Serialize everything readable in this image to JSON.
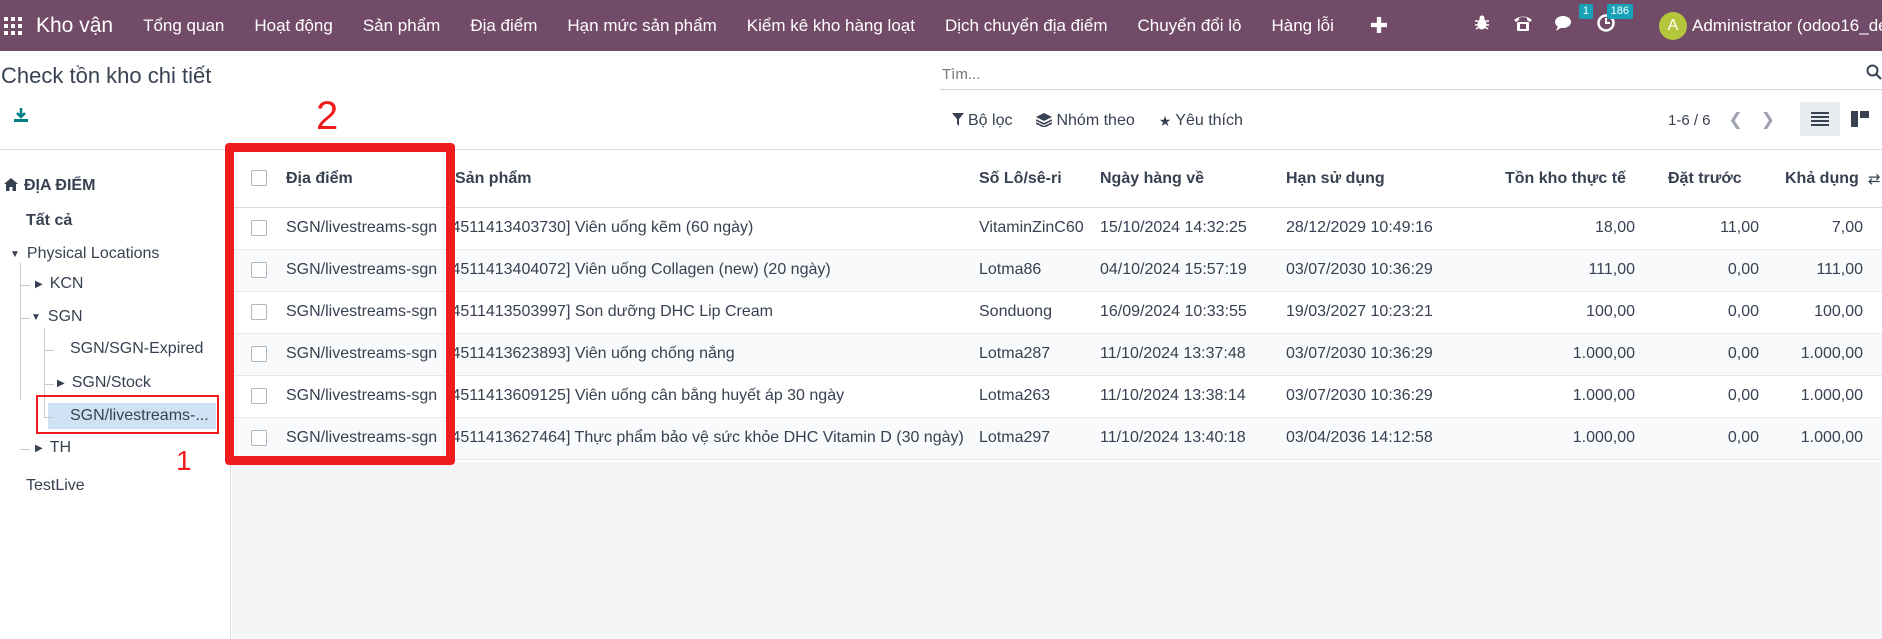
{
  "navbar": {
    "brand": "Kho vận",
    "menu": [
      "Tổng quan",
      "Hoạt động",
      "Sản phẩm",
      "Địa điểm",
      "Hạn mức sản phẩm",
      "Kiểm kê kho hàng loạt",
      "Dịch chuyển địa điểm",
      "Chuyển đổi lô",
      "Hàng lỗi"
    ],
    "chat_badge": "1",
    "activity_badge": "186",
    "avatar_letter": "A",
    "username": "Administrator (odoo16_dev"
  },
  "page": {
    "title": "Check tồn kho chi tiết",
    "search_placeholder": "Tìm...",
    "filter_label": "Bộ lọc",
    "group_label": "Nhóm theo",
    "favorite_label": "Yêu thích",
    "pager": "1-6 / 6"
  },
  "sidebar": {
    "header": "ĐỊA ĐIỂM",
    "all": "Tất cả",
    "physical": "Physical Locations",
    "kcn": "KCN",
    "sgn": "SGN",
    "sgn_expired": "SGN/SGN-Expired",
    "sgn_stock": "SGN/Stock",
    "sgn_live": "SGN/livestreams-...",
    "th": "TH",
    "testlive": "TestLive"
  },
  "annotations": {
    "label_1": "1",
    "label_2": "2"
  },
  "table": {
    "headers": {
      "location": "Địa điểm",
      "product": "Sản phẩm",
      "lot": "Số Lô/sê-ri",
      "arrival": "Ngày hàng về",
      "expiry": "Hạn sử dụng",
      "on_hand": "Tồn kho thực tế",
      "reserved": "Đặt trước",
      "available": "Khả dụng"
    },
    "rows": [
      {
        "location": "SGN/livestreams-sgn",
        "product": "[4511413403730] Viên uống kẽm (60 ngày)",
        "lot": "VitaminZinC60",
        "arrival": "15/10/2024 14:32:25",
        "expiry": "28/12/2029 10:49:16",
        "on_hand": "18,00",
        "reserved": "11,00",
        "available": "7,00"
      },
      {
        "location": "SGN/livestreams-sgn",
        "product": "[4511413404072] Viên uống Collagen (new) (20 ngày)",
        "lot": "Lotma86",
        "arrival": "04/10/2024 15:57:19",
        "expiry": "03/07/2030 10:36:29",
        "on_hand": "111,00",
        "reserved": "0,00",
        "available": "111,00"
      },
      {
        "location": "SGN/livestreams-sgn",
        "product": "[4511413503997] Son dưỡng DHC Lip Cream",
        "lot": "Sonduong",
        "arrival": "16/09/2024 10:33:55",
        "expiry": "19/03/2027 10:23:21",
        "on_hand": "100,00",
        "reserved": "0,00",
        "available": "100,00"
      },
      {
        "location": "SGN/livestreams-sgn",
        "product": "[4511413623893] Viên uống chống nắng",
        "lot": "Lotma287",
        "arrival": "11/10/2024 13:37:48",
        "expiry": "03/07/2030 10:36:29",
        "on_hand": "1.000,00",
        "reserved": "0,00",
        "available": "1.000,00"
      },
      {
        "location": "SGN/livestreams-sgn",
        "product": "[4511413609125] Viên uống cân bằng huyết áp 30 ngày",
        "lot": "Lotma263",
        "arrival": "11/10/2024 13:38:14",
        "expiry": "03/07/2030 10:36:29",
        "on_hand": "1.000,00",
        "reserved": "0,00",
        "available": "1.000,00"
      },
      {
        "location": "SGN/livestreams-sgn",
        "product": "[4511413627464] Thực phẩm bảo vệ sức khỏe DHC Vitamin D (30 ngày)",
        "lot": "Lotma297",
        "arrival": "11/10/2024 13:40:18",
        "expiry": "03/04/2036 14:12:58",
        "on_hand": "1.000,00",
        "reserved": "0,00",
        "available": "1.000,00"
      }
    ]
  }
}
